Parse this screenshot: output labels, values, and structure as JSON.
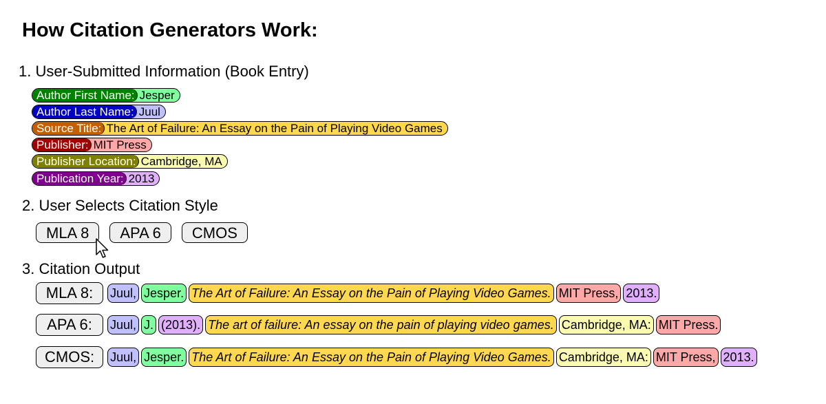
{
  "title": "How Citation Generators Work:",
  "colors": {
    "first_name": {
      "label_bg": "#008000",
      "value_bg": "#80ff9f"
    },
    "last_name": {
      "label_bg": "#0000c0",
      "value_bg": "#c0c0ff"
    },
    "title": {
      "label_bg": "#c06000",
      "value_bg": "#ffd850"
    },
    "publisher": {
      "label_bg": "#a00000",
      "value_bg": "#ffa8a8"
    },
    "location": {
      "label_bg": "#808000",
      "value_bg": "#fafab0"
    },
    "year": {
      "label_bg": "#800090",
      "value_bg": "#e0b0ff"
    }
  },
  "step1": {
    "heading": "1. User-Submitted Information (Book Entry)",
    "fields": [
      {
        "key": "first_name",
        "label": "Author First Name:",
        "value": "Jesper"
      },
      {
        "key": "last_name",
        "label": "Author Last Name:",
        "value": "Juul"
      },
      {
        "key": "title",
        "label": "Source Title:",
        "value": "The Art of Failure: An Essay on the Pain of Playing Video Games"
      },
      {
        "key": "publisher",
        "label": "Publisher:",
        "value": "MIT Press"
      },
      {
        "key": "location",
        "label": "Publisher Location:",
        "value": "Cambridge, MA"
      },
      {
        "key": "year",
        "label": "Publication Year:",
        "value": "2013"
      }
    ]
  },
  "step2": {
    "heading": "2. User Selects Citation Style",
    "buttons": [
      "MLA 8",
      "APA 6",
      "CMOS"
    ],
    "cursor_on": "MLA 8"
  },
  "step3": {
    "heading": "3. Citation Output",
    "rows": [
      {
        "label": "MLA 8:",
        "parts": [
          {
            "key": "last_name",
            "text": "Juul,"
          },
          {
            "key": "first_name",
            "text": "Jesper."
          },
          {
            "key": "title",
            "text": "The Art of Failure: An Essay on the Pain of Playing Video Games.",
            "italic": true
          },
          {
            "key": "publisher",
            "text": "MIT Press,"
          },
          {
            "key": "year",
            "text": "2013."
          }
        ]
      },
      {
        "label": "APA 6:",
        "parts": [
          {
            "key": "last_name",
            "text": "Juul,"
          },
          {
            "key": "first_name",
            "text": "J."
          },
          {
            "key": "year",
            "text": "(2013)."
          },
          {
            "key": "title",
            "text": "The art of failure: An essay on the pain of playing video games.",
            "italic": true
          },
          {
            "key": "location",
            "text": "Cambridge, MA:"
          },
          {
            "key": "publisher",
            "text": "MIT Press."
          }
        ]
      },
      {
        "label": "CMOS:",
        "parts": [
          {
            "key": "last_name",
            "text": "Juul,"
          },
          {
            "key": "first_name",
            "text": "Jesper."
          },
          {
            "key": "title",
            "text": "The Art of Failure: An Essay on the Pain of Playing Video Games.",
            "italic": true
          },
          {
            "key": "location",
            "text": "Cambridge, MA:"
          },
          {
            "key": "publisher",
            "text": "MIT Press,"
          },
          {
            "key": "year",
            "text": "2013."
          }
        ]
      }
    ]
  }
}
